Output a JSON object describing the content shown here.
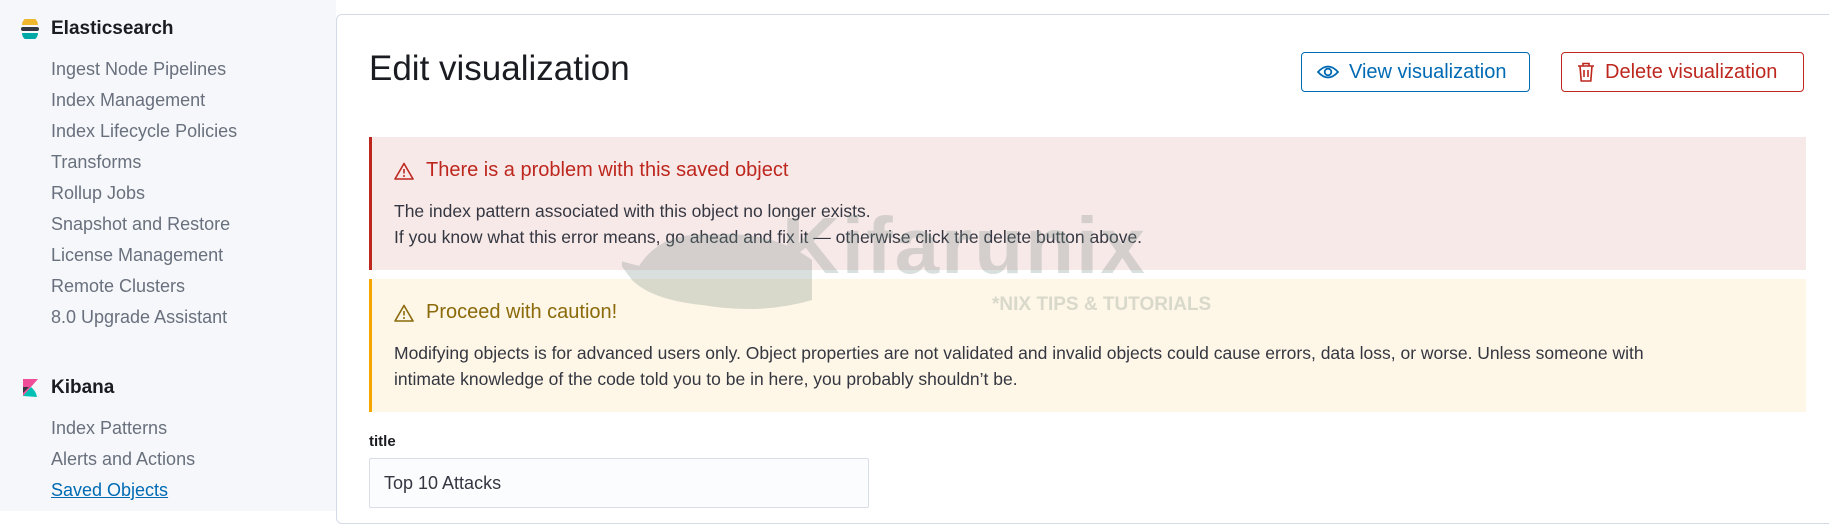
{
  "sidebar": {
    "elasticsearch": {
      "title": "Elasticsearch",
      "items": [
        {
          "label": "Ingest Node Pipelines"
        },
        {
          "label": "Index Management"
        },
        {
          "label": "Index Lifecycle Policies"
        },
        {
          "label": "Transforms"
        },
        {
          "label": "Rollup Jobs"
        },
        {
          "label": "Snapshot and Restore"
        },
        {
          "label": "License Management"
        },
        {
          "label": "Remote Clusters"
        },
        {
          "label": "8.0 Upgrade Assistant"
        }
      ]
    },
    "kibana": {
      "title": "Kibana",
      "items": [
        {
          "label": "Index Patterns"
        },
        {
          "label": "Alerts and Actions"
        },
        {
          "label": "Saved Objects",
          "active": true
        }
      ]
    }
  },
  "main": {
    "title": "Edit visualization",
    "view_button": {
      "label": "View visualization",
      "icon": "eye-icon"
    },
    "delete_button": {
      "label": "Delete visualization",
      "icon": "trash-icon"
    },
    "danger_callout": {
      "title": "There is a problem with this saved object",
      "icon": "warning-icon",
      "lines": [
        "The index pattern associated with this object no longer exists.",
        "If you know what this error means, go ahead and fix it — otherwise click the delete button above."
      ]
    },
    "warning_callout": {
      "title": "Proceed with caution!",
      "icon": "warning-icon",
      "lines": [
        "Modifying objects is for advanced users only. Object properties are not validated and invalid objects could cause errors, data loss, or worse. Unless someone with",
        "intimate knowledge of the code told you to be in here, you probably shouldn’t be."
      ]
    },
    "title_field": {
      "label": "title",
      "value": "Top 10 Attacks"
    }
  },
  "watermark": {
    "text": "Kifarunix",
    "subtext": "*NIX TIPS & TUTORIALS"
  },
  "colors": {
    "primary": "#006bb4",
    "danger": "#bd271e",
    "warning": "#f5a700",
    "danger_bg": "#f8e9e9",
    "warning_bg": "#fef6e6"
  }
}
